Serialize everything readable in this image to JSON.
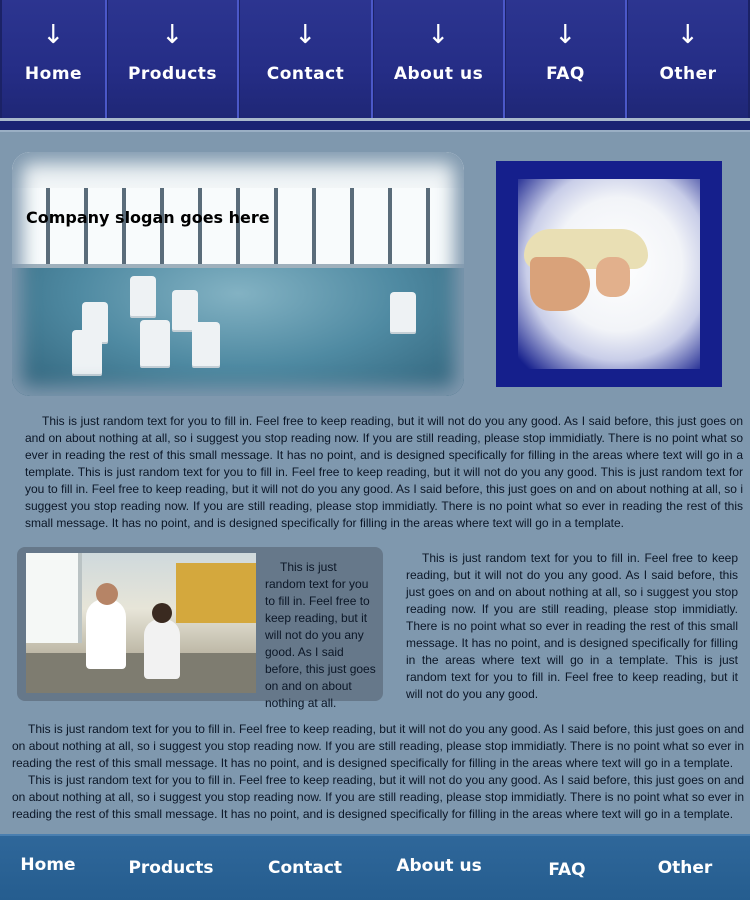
{
  "top_nav": {
    "arrow": "↓",
    "items": [
      {
        "label": "Home"
      },
      {
        "label": "Products"
      },
      {
        "label": "Contact"
      },
      {
        "label": "About us"
      },
      {
        "label": "FAQ"
      },
      {
        "label": "Other"
      }
    ]
  },
  "hero": {
    "slogan": "Company slogan goes here"
  },
  "content": {
    "paragraph1": "This is just random text for you to fill in.  Feel free to keep reading, but it will not do you any good.  As I said before, this just goes on and on about nothing at all, so i suggest you stop reading now.  If you are still reading, please stop immidiatly.  There is no point what so ever in reading the rest of this small message.  It has no point, and is designed specifically for filling in the areas where text will go in a template.  This is just random text for you to fill in.  Feel free to keep reading, but it will not do you any good. This is just random text for you to fill in.  Feel free to keep reading, but it will not do you any good.  As I said before, this just goes on and on about nothing at all, so i suggest you stop reading now.  If you are still reading, please stop immidiatly.  There is no point what so ever in reading the rest of this small message.  It has no point, and is designed specifically for filling in the areas where text will go in a template.",
    "card_text": "This is just random text for you to fill in.  Feel free to keep reading, but it will not do you any good.  As I said before, this just goes on and on about nothing at all.",
    "paragraph2": "This is just random text for you to fill in.  Feel free to keep reading, but it will not do you any good.  As I said before, this just goes on and on about nothing at all, so i suggest you stop reading now.  If you are still reading, please stop immidiatly.  There is no point what so ever in reading the rest of this small message.  It has no point, and is designed specifically for filling in the areas where text will go in a template. This is just random text for you to fill in.  Feel free to keep reading, but it will not do you any good.",
    "paragraph3a": "This is just random text for you to fill in.  Feel free to keep reading, but it will not do you any good.  As I said before, this just goes on and on about nothing at all, so i suggest you stop reading now.  If you are still reading, please stop immidiatly.  There is no point what so ever in reading the rest of this small message.  It has no point, and is designed specifically for filling in the areas where text will go in a template.",
    "paragraph3b": "This is just random text for you to fill in.  Feel free to keep reading, but it will not do you any good.  As I said before, this just goes on and on about nothing at all, so i suggest you stop reading now.  If you are still reading, please stop immidiatly.  There is no point what so ever in reading the rest of this small message.  It has no point, and is designed specifically for filling in the areas where text will go in a template."
  },
  "bottom_nav": {
    "items": [
      {
        "label": "Home"
      },
      {
        "label": "Products"
      },
      {
        "label": "Contact"
      },
      {
        "label": "About us"
      },
      {
        "label": "FAQ"
      },
      {
        "label": "Other"
      }
    ]
  },
  "colors": {
    "page_background": "#7f98ae",
    "top_nav": "#26307a",
    "bottom_nav": "#2f679a",
    "photo_frame": "#151f8c"
  }
}
